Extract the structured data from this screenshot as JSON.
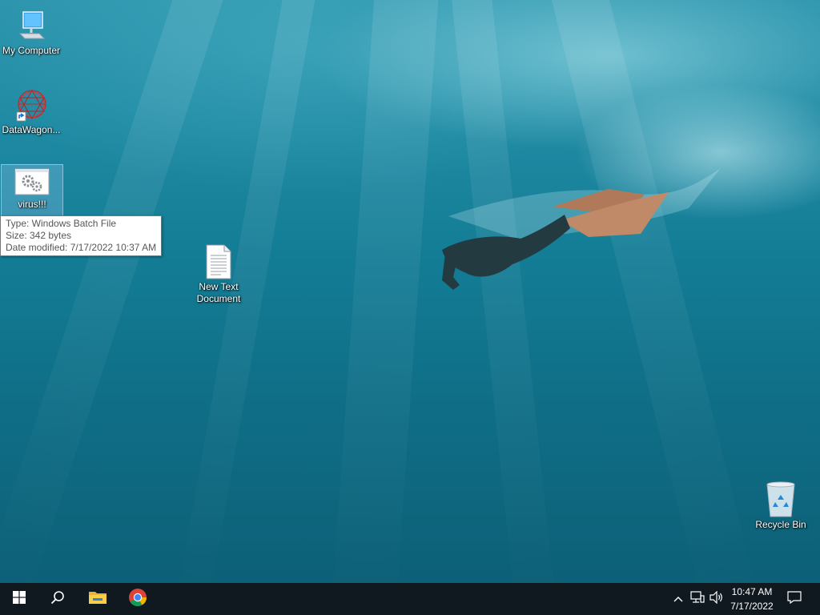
{
  "desktop": {
    "icons": [
      {
        "name": "my-computer",
        "label": "My Computer"
      },
      {
        "name": "datawagon",
        "label": "DataWagon..."
      },
      {
        "name": "virus-batch-file",
        "label": "virus!!!"
      },
      {
        "name": "new-text-document",
        "label": "New Text Document"
      },
      {
        "name": "recycle-bin",
        "label": "Recycle Bin"
      }
    ],
    "tooltip": {
      "type": "Type: Windows Batch File",
      "size": "Size: 342 bytes",
      "modified": "Date modified: 7/17/2022 10:37 AM"
    }
  },
  "taskbar": {
    "start_icon": "windows-logo-icon",
    "search_icon": "search-icon",
    "pinned": [
      {
        "name": "file-explorer",
        "icon": "folder-icon"
      },
      {
        "name": "chrome",
        "icon": "chrome-icon"
      }
    ],
    "tray_icons": [
      "chevron-up-icon",
      "network-icon",
      "volume-icon"
    ],
    "clock": {
      "time": "10:47 AM",
      "date": "7/17/2022"
    },
    "notification_icon": "action-center-icon"
  },
  "colors": {
    "taskbar_bg": "#101820",
    "selection": "#add8ff",
    "water": "#137c95"
  }
}
